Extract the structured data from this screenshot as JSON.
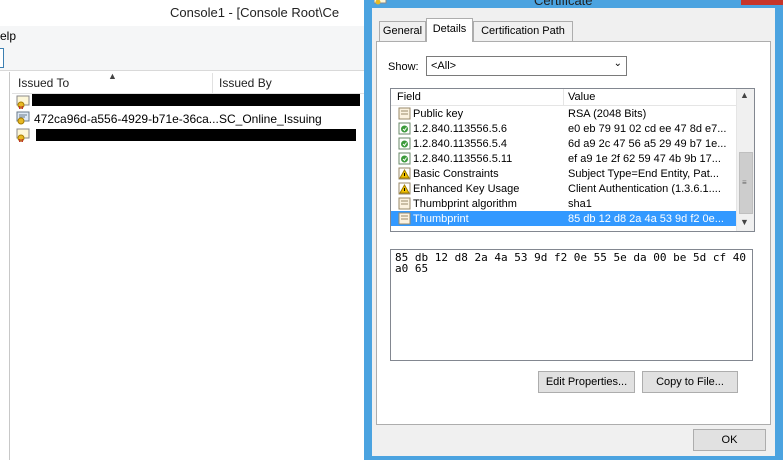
{
  "console": {
    "title": "Console1 - [Console Root\\Ce",
    "menu_help": "elp",
    "columns": {
      "issued_to": "Issued To",
      "issued_by": "Issued By"
    },
    "rows": [
      {
        "issued_to": "",
        "issued_by": "",
        "redacted": true
      },
      {
        "issued_to": "472ca96d-a556-4929-b71e-36ca...",
        "issued_by": "SC_Online_Issuing",
        "redacted": false
      },
      {
        "issued_to": "",
        "issued_by": "",
        "redacted": true
      }
    ]
  },
  "dialog": {
    "title": "Certificate",
    "tabs": [
      "General",
      "Details",
      "Certification Path"
    ],
    "active_tab": "Details",
    "show_label": "Show:",
    "show_value": "<All>",
    "fields_header": {
      "field": "Field",
      "value": "Value"
    },
    "fields": [
      {
        "icon": "doc-icon",
        "field": "Public key",
        "value": "RSA (2048 Bits)"
      },
      {
        "icon": "extension-icon",
        "field": "1.2.840.113556.5.6",
        "value": "e0 eb 79 91 02 cd ee 47 8d e7..."
      },
      {
        "icon": "extension-icon",
        "field": "1.2.840.113556.5.4",
        "value": "6d a9 2c 47 56 a5 29 49 b7 1e..."
      },
      {
        "icon": "extension-icon",
        "field": "1.2.840.113556.5.11",
        "value": "ef a9 1e 2f 62 59 47 4b 9b 17..."
      },
      {
        "icon": "warning-icon",
        "field": "Basic Constraints",
        "value": "Subject Type=End Entity, Pat..."
      },
      {
        "icon": "warning-icon",
        "field": "Enhanced Key Usage",
        "value": "Client Authentication (1.3.6.1...."
      },
      {
        "icon": "doc-icon",
        "field": "Thumbprint algorithm",
        "value": "sha1"
      },
      {
        "icon": "doc-icon",
        "field": "Thumbprint",
        "value": "85 db 12 d8 2a 4a 53 9d f2 0e..."
      }
    ],
    "selected_field": "Thumbprint",
    "value_text": "85 db 12 d8 2a 4a 53 9d f2 0e 55 5e da 00 be 5d cf 40 a0 65",
    "buttons": {
      "edit": "Edit Properties...",
      "copy": "Copy to File...",
      "ok": "OK"
    }
  }
}
